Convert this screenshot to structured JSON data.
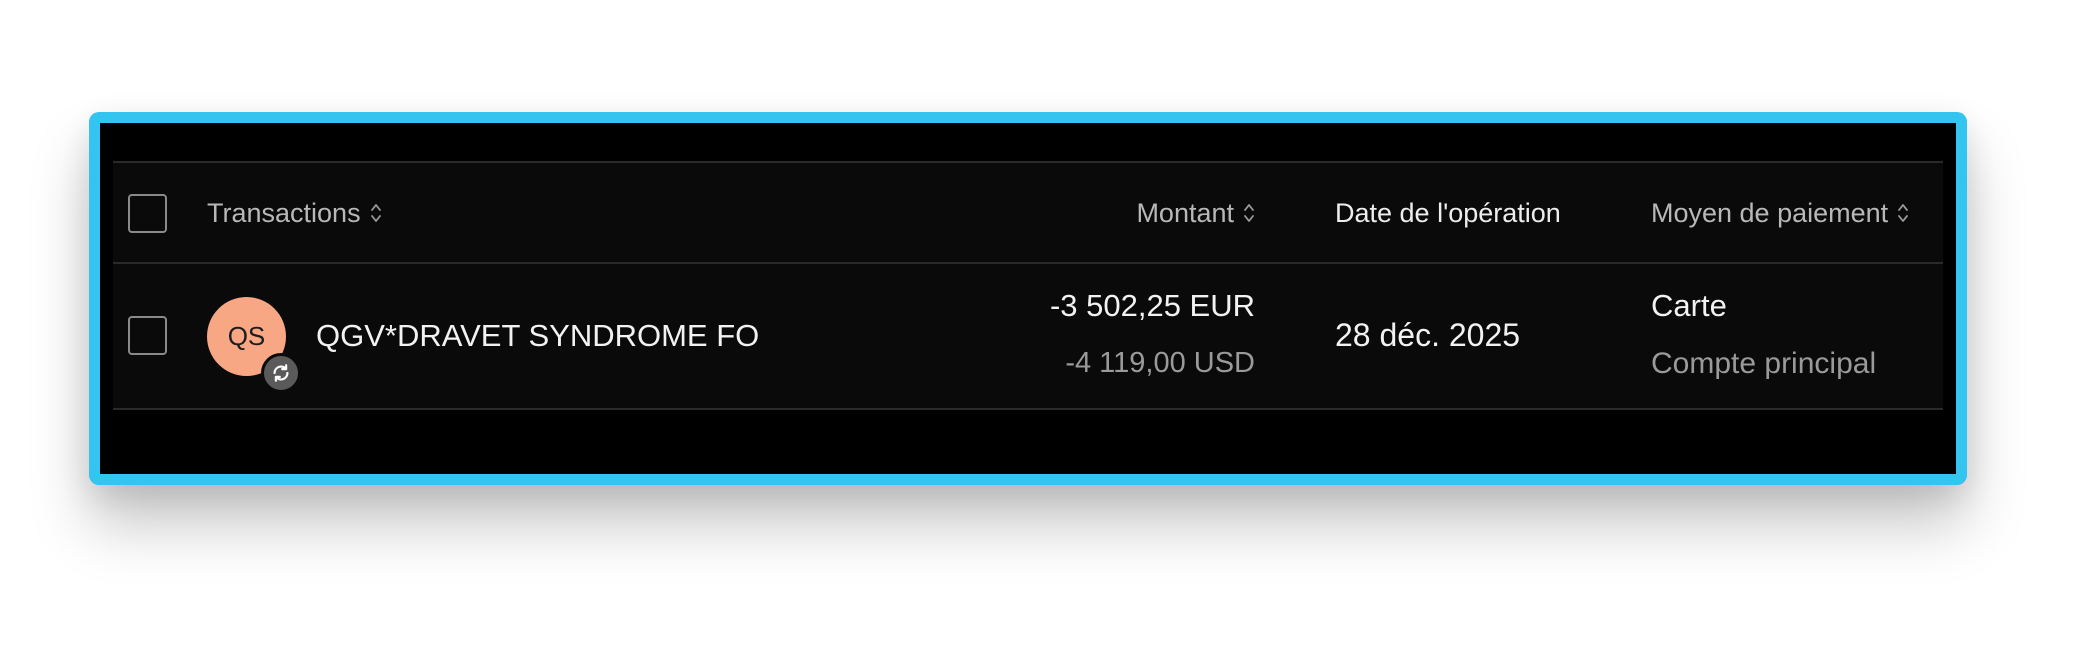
{
  "table": {
    "columns": {
      "transactions": "Transactions",
      "amount": "Montant",
      "date": "Date de l'opération",
      "payment": "Moyen de paiement"
    },
    "rows": [
      {
        "avatar_initials": "QS",
        "avatar_color": "#f7a784",
        "badge_icon": "recurring-icon",
        "merchant": "QGV*DRAVET SYNDROME FO",
        "amount": "-3 502,25 EUR",
        "amount_original": "-4 119,00 USD",
        "date": "28 déc. 2025",
        "payment_method": "Carte",
        "account": "Compte principal"
      }
    ]
  },
  "icons": {
    "sort": "sort-icon",
    "checkbox": "checkbox"
  },
  "colors": {
    "frame_border": "#33c4ef",
    "background": "#000000",
    "avatar": "#f7a784"
  }
}
